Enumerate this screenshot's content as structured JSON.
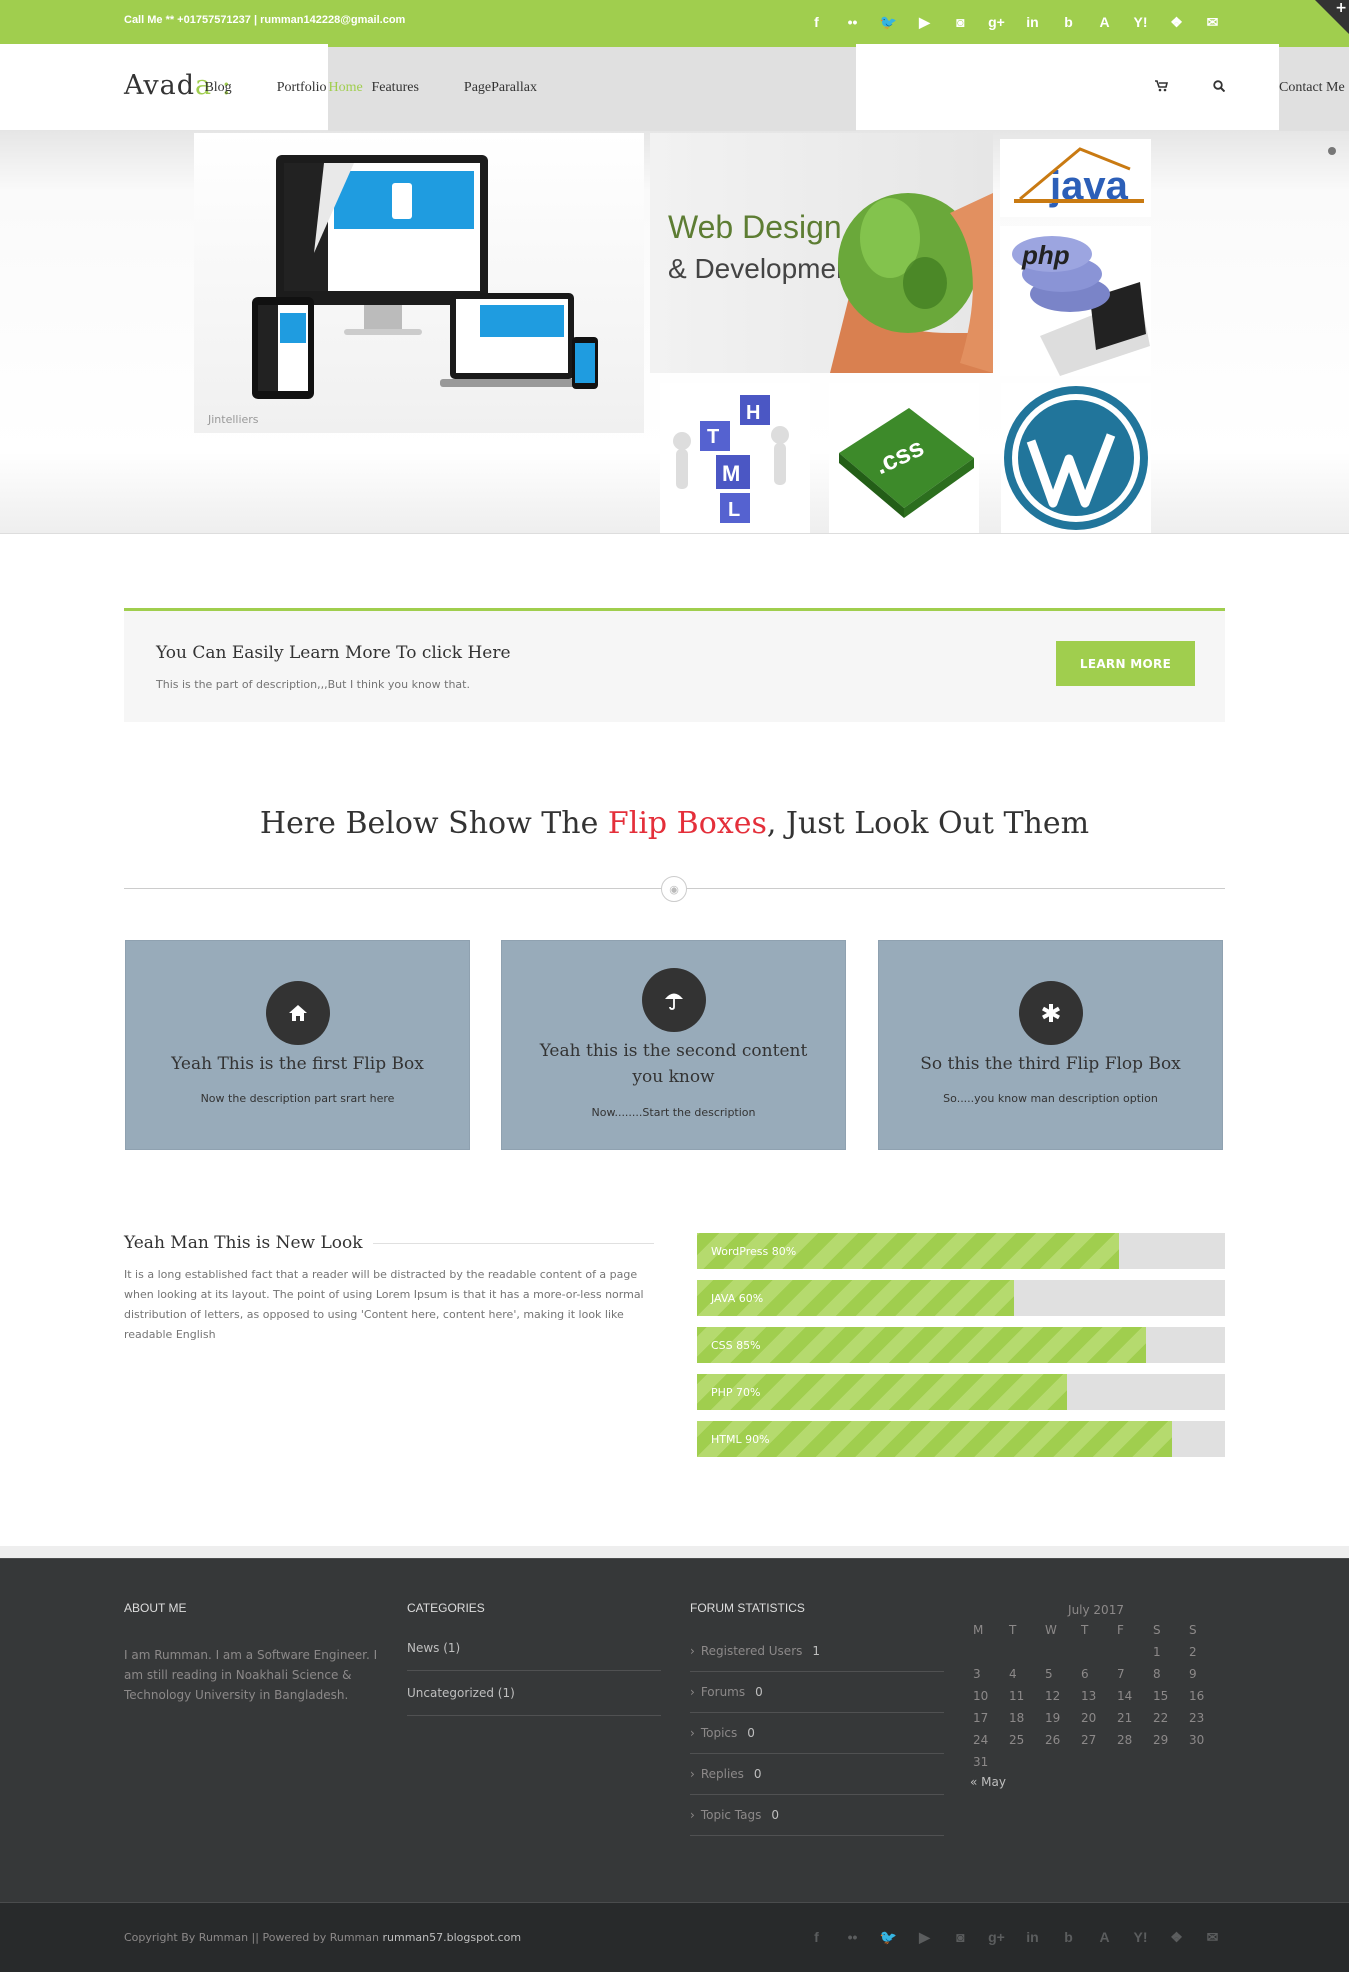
{
  "topbar": {
    "contact": "Call Me ** +01757571237  |  rumman142228@gmail.com",
    "socials": [
      "f",
      "••",
      "🐦",
      "▶",
      "◙",
      "g+",
      "in",
      "b",
      "A",
      "Y!",
      "❖",
      "✉"
    ],
    "corner": "+"
  },
  "header": {
    "logo_main": "Avad",
    "logo_accent": "a :",
    "nav": [
      {
        "label": "Home"
      },
      {
        "label": "Blog"
      },
      {
        "label": "Portfolio"
      },
      {
        "label": "Features"
      },
      {
        "label": "PageParallax"
      },
      {
        "label": "Contact Me"
      }
    ],
    "cart_icon": "cart-icon",
    "search_icon": "search-icon"
  },
  "hero": {
    "web_design_line1": "Web Design",
    "web_design_line2": "& Development",
    "java": "java",
    "php": "php",
    "css": ".css",
    "html_letters": [
      "H",
      "T",
      "M",
      "L"
    ],
    "watermark": "Jintelliers"
  },
  "promo": {
    "title": "You Can Easily Learn More To click Here",
    "desc": "This is the part of description,,,But I think you know that.",
    "button": "LEARN MORE"
  },
  "section_title": {
    "before": "Here Below Show The ",
    "highlight": "Flip Boxes",
    "after": ", Just Look Out Them"
  },
  "flip_boxes": [
    {
      "icon": "home-icon",
      "glyph": "⌂",
      "title": "Yeah This is the first Flip Box",
      "desc": "Now the description part srart here"
    },
    {
      "icon": "umbrella-icon",
      "glyph": "☂",
      "title": "Yeah this is the second content you know",
      "desc": "Now........Start the description"
    },
    {
      "icon": "asterisk-icon",
      "glyph": "✱",
      "title": "So this the third Flip Flop Box",
      "desc": "So.....you know man description option"
    }
  ],
  "about": {
    "title": "Yeah Man This is New Look",
    "text": "It is a long established fact that a reader will be distracted by the readable content of a page when looking at its layout. The point of using Lorem Ipsum is that it has a more-or-less normal distribution of letters, as opposed to using 'Content here, content here', making it look like readable English"
  },
  "progress_bars": [
    {
      "label": "WordPress 80%",
      "value": 0.8
    },
    {
      "label": "JAVA 60%",
      "value": 0.6
    },
    {
      "label": "CSS 85%",
      "value": 0.85
    },
    {
      "label": "PHP 70%",
      "value": 0.7
    },
    {
      "label": "HTML 90%",
      "value": 0.9
    }
  ],
  "footer": {
    "about_heading": "ABOUT ME",
    "about_text": "I am Rumman. I am a Software Engineer. I am still reading in Noakhali Science & Technology University in Bangladesh.",
    "categories_heading": "CATEGORIES",
    "categories": [
      "News (1)",
      "Uncategorized (1)"
    ],
    "forum_heading": "FORUM STATISTICS",
    "forum": [
      {
        "label": "Registered Users",
        "count": "1"
      },
      {
        "label": "Forums",
        "count": "0"
      },
      {
        "label": "Topics",
        "count": "0"
      },
      {
        "label": "Replies",
        "count": "0"
      },
      {
        "label": "Topic Tags",
        "count": "0"
      }
    ],
    "calendar": {
      "caption": "July 2017",
      "days": [
        "M",
        "T",
        "W",
        "T",
        "F",
        "S",
        "S"
      ],
      "weeks": [
        [
          "",
          "",
          "",
          "",
          "",
          "1",
          "2"
        ],
        [
          "3",
          "4",
          "5",
          "6",
          "7",
          "8",
          "9"
        ],
        [
          "10",
          "11",
          "12",
          "13",
          "14",
          "15",
          "16"
        ],
        [
          "17",
          "18",
          "19",
          "20",
          "21",
          "22",
          "23"
        ],
        [
          "24",
          "25",
          "26",
          "27",
          "28",
          "29",
          "30"
        ],
        [
          "31",
          "",
          "",
          "",
          "",
          "",
          ""
        ]
      ],
      "prev": "« May"
    }
  },
  "copyright": {
    "text": "Copyright By Rumman || Powered by Rumman ",
    "link": "rumman57.blogspot.com"
  },
  "colors": {
    "accent": "#a0ce4e",
    "highlight": "#e42f3a",
    "flip_bg": "#98abba",
    "footer_bg": "#363839"
  }
}
